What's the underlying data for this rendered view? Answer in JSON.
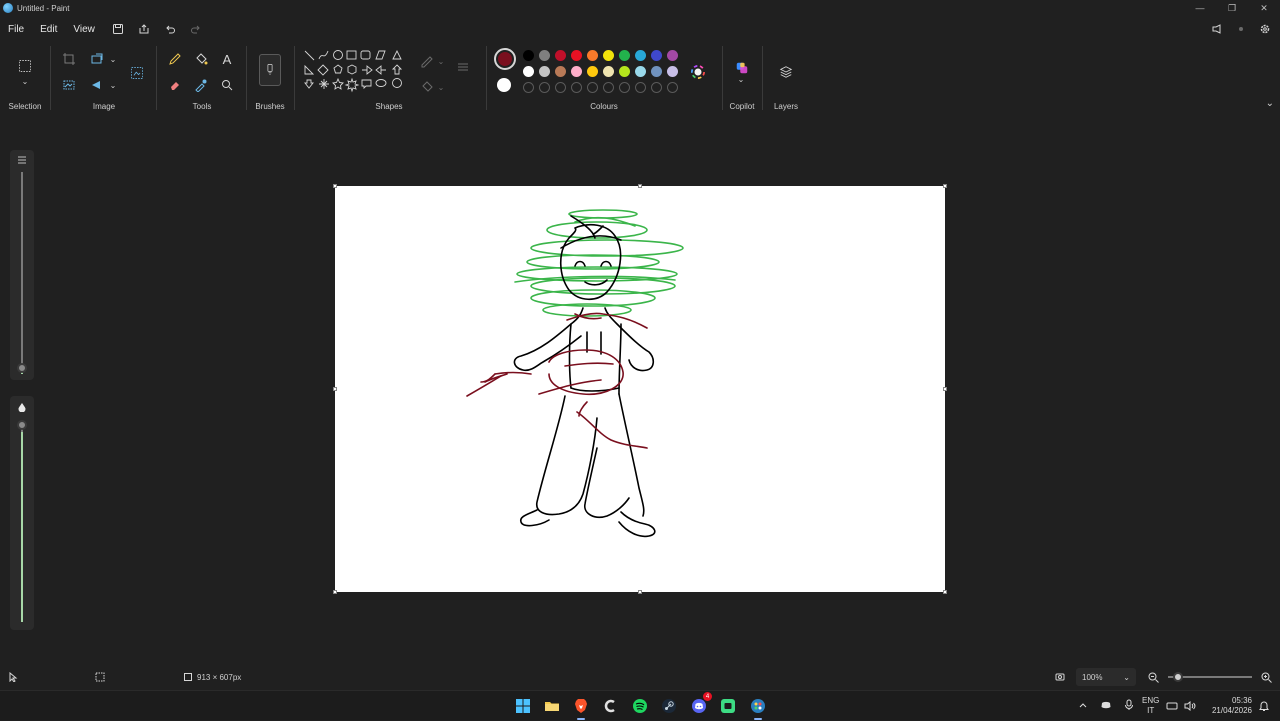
{
  "window": {
    "title": "Untitled - Paint",
    "controls": [
      "—",
      "❐",
      "✕"
    ]
  },
  "menu": {
    "file": "File",
    "edit": "Edit",
    "view": "View"
  },
  "ribbon": {
    "selection_label": "Selection",
    "image_label": "Image",
    "tools_label": "Tools",
    "brushes_label": "Brushes",
    "shapes_label": "Shapes",
    "colours_label": "Colours",
    "copilot_label": "Copilot",
    "layers_label": "Layers",
    "primary_colour": "#7a0f1e",
    "secondary_colour": "#ffffff",
    "palette_row1": [
      "#000000",
      "#7f7f7f",
      "#c0102a",
      "#e81123",
      "#f7792a",
      "#f2e30b",
      "#22b24c",
      "#28a8d8",
      "#3f48cc",
      "#a349a4"
    ],
    "palette_row2": [
      "#ffffff",
      "#c3c3c3",
      "#b97a57",
      "#ffaec9",
      "#ffc90e",
      "#efe4b0",
      "#b5e61d",
      "#99d9ea",
      "#7092be",
      "#c8bfe7"
    ]
  },
  "status": {
    "canvas_size": "913 × 607px",
    "zoom": "100%",
    "zoom_level": 0.12
  },
  "taskbar": {
    "lang_top": "ENG",
    "lang_bottom": "IT",
    "time": "05:36",
    "date": "21/04/2026",
    "discord_badge": "4"
  }
}
